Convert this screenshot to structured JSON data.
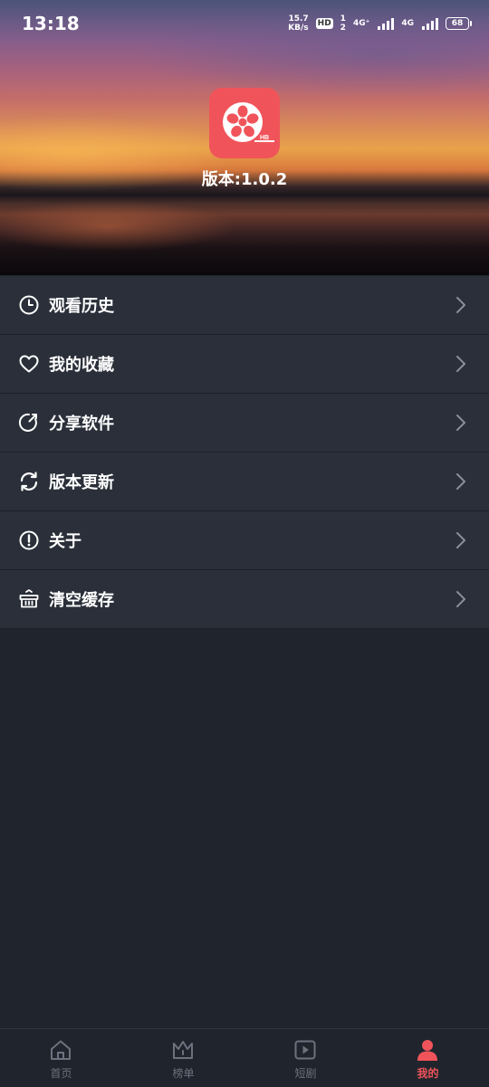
{
  "status_bar": {
    "time": "13:18",
    "speed_value": "15.7",
    "speed_unit": "KB/s",
    "hd": "HD",
    "sim1": "1",
    "sim2": "2",
    "net1": "4G⁺",
    "net2": "4G",
    "battery": "68"
  },
  "header": {
    "logo_icon": "film-reel-icon",
    "logo_badge": "HB",
    "version": "版本:1.0.2"
  },
  "menu": {
    "items": [
      {
        "label": "观看历史",
        "icon": "clock-icon"
      },
      {
        "label": "我的收藏",
        "icon": "heart-icon"
      },
      {
        "label": "分享软件",
        "icon": "share-icon"
      },
      {
        "label": "版本更新",
        "icon": "refresh-icon"
      },
      {
        "label": "关于",
        "icon": "info-icon"
      },
      {
        "label": "清空缓存",
        "icon": "basket-icon"
      }
    ]
  },
  "bottom_nav": {
    "items": [
      {
        "label": "首页",
        "icon": "home-icon"
      },
      {
        "label": "榜单",
        "icon": "crown-icon"
      },
      {
        "label": "短剧",
        "icon": "play-icon"
      },
      {
        "label": "我的",
        "icon": "user-icon"
      }
    ],
    "active_index": 3
  },
  "colors": {
    "accent": "#f0545a",
    "background": "#20252d",
    "menu_background": "#2a2f39",
    "inactive": "#6b727e"
  }
}
